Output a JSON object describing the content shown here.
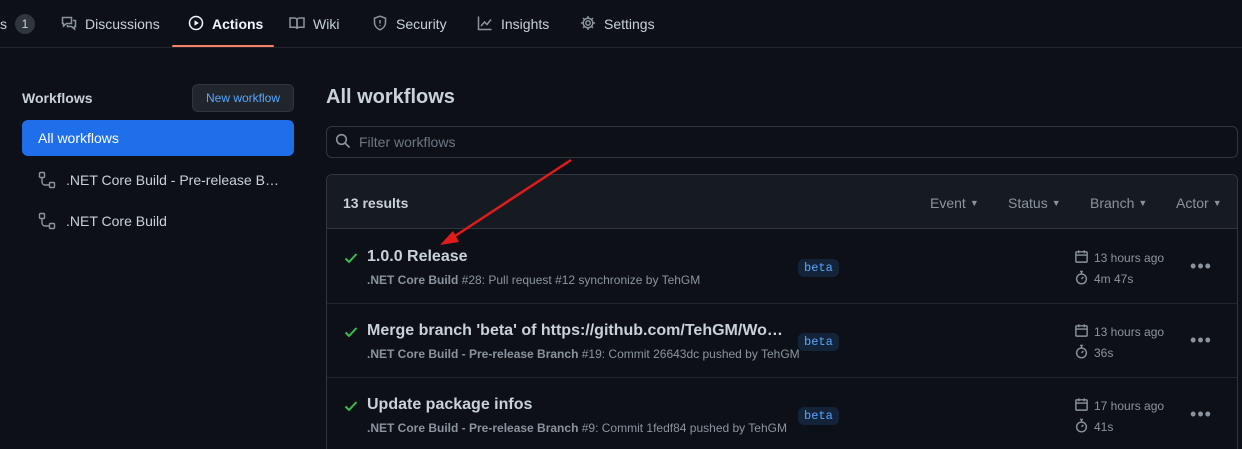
{
  "topnav": {
    "partial_tab": {
      "label": "s",
      "count": "1"
    },
    "tabs": [
      {
        "label": "Discussions",
        "icon": "comment-discussion-icon"
      },
      {
        "label": "Actions",
        "icon": "play-icon",
        "active": true
      },
      {
        "label": "Wiki",
        "icon": "book-icon"
      },
      {
        "label": "Security",
        "icon": "shield-icon"
      },
      {
        "label": "Insights",
        "icon": "graph-icon"
      },
      {
        "label": "Settings",
        "icon": "gear-icon"
      }
    ]
  },
  "sidebar": {
    "title": "Workflows",
    "new_workflow_label": "New workflow",
    "items": [
      {
        "label": "All workflows",
        "selected": true
      },
      {
        "label": ".NET Core Build - Pre-release Branch",
        "icon": "workflow-icon"
      },
      {
        "label": ".NET Core Build",
        "icon": "workflow-icon"
      }
    ]
  },
  "main": {
    "title": "All workflows",
    "filter_placeholder": "Filter workflows",
    "results_count": "13 results",
    "filters": [
      "Event",
      "Status",
      "Branch",
      "Actor"
    ],
    "runs": [
      {
        "status": "success",
        "title": "1.0.0 Release",
        "workflow": ".NET Core Build",
        "meta": " #28: Pull request #12 synchronize by TehGM",
        "branch": "beta",
        "time_ago": "13 hours ago",
        "duration": "4m 47s"
      },
      {
        "status": "success",
        "title": "Merge branch 'beta' of https://github.com/TehGM/Wol…",
        "workflow": ".NET Core Build - Pre-release Branch",
        "meta": " #19: Commit 26643dc pushed by TehGM",
        "branch": "beta",
        "time_ago": "13 hours ago",
        "duration": "36s"
      },
      {
        "status": "success",
        "title": "Update package infos",
        "workflow": ".NET Core Build - Pre-release Branch",
        "meta": " #9: Commit 1fedf84 pushed by TehGM",
        "branch": "beta",
        "time_ago": "17 hours ago",
        "duration": "41s"
      }
    ]
  },
  "colors": {
    "background": "#0d1117",
    "accent_blue": "#1f6feb",
    "tab_underline": "#f78166",
    "success_green": "#3fb950",
    "annotation_arrow": "#e01b1b"
  }
}
